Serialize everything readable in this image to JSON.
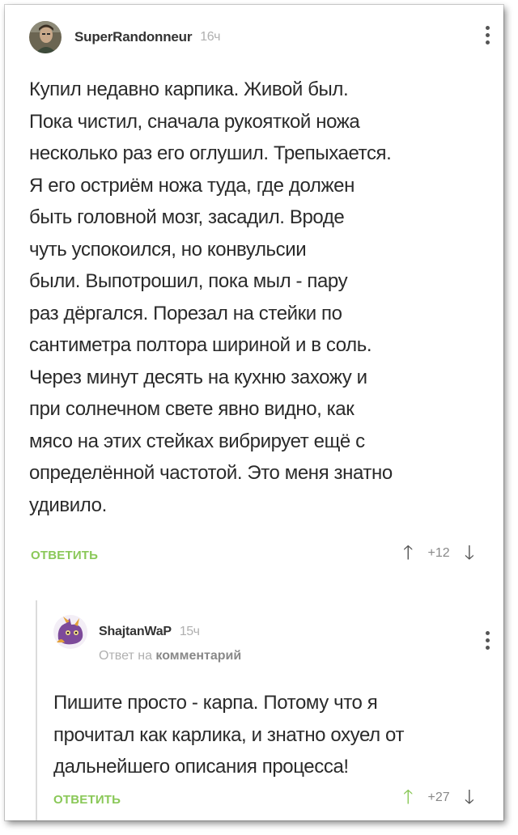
{
  "comment": {
    "username": "SuperRandonneur",
    "time": "16ч",
    "text_lines": [
      "Купил недавно карпика. Живой был.",
      "Пока чистил, сначала рукояткой ножа",
      "несколько раз его оглушил. Трепыхается.",
      "Я его остриём ножа туда, где должен",
      "быть головной мозг, засадил. Вроде",
      "чуть успокоился, но конвульсии",
      "были. Выпотрошил, пока мыл - пару",
      "раз дёргался. Порезал на стейки по",
      "сантиметра полтора шириной и в соль.",
      "Через минут десять на кухню захожу и",
      "при солнечном свете явно видно, как",
      "мясо на этих стейках вибрирует ещё с",
      "определённой частотой. Это меня знатно",
      "удивило."
    ],
    "reply_label": "ОТВЕТИТЬ",
    "rating": "+12",
    "upvoted": false
  },
  "reply": {
    "username": "ShajtanWaP",
    "time": "15ч",
    "reply_to_prefix": "Ответ на",
    "reply_to_target": "комментарий",
    "text_lines": [
      "Пишите просто - карпа. Потому что я",
      "прочитал как карлика, и знатно охуел от",
      "дальнейшего описания процесса!"
    ],
    "reply_label": "ОТВЕТИТЬ",
    "rating": "+27",
    "upvoted": true
  },
  "colors": {
    "accent_green": "#8ac858",
    "text": "#2a2a2a",
    "muted": "#b0b0b0"
  },
  "icons": {
    "upvote": "arrow-up-icon",
    "downvote": "arrow-down-icon",
    "menu": "more-vertical-icon"
  }
}
